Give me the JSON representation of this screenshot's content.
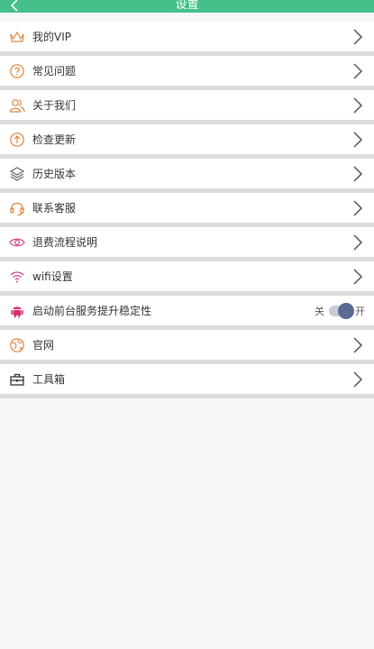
{
  "header": {
    "title": "设置"
  },
  "items": [
    {
      "key": "vip",
      "label": "我的VIP",
      "icon": "crown-icon",
      "color": "#e0833a"
    },
    {
      "key": "faq",
      "label": "常见问题",
      "icon": "question-icon",
      "color": "#e0833a"
    },
    {
      "key": "about",
      "label": "关于我们",
      "icon": "people-icon",
      "color": "#e0833a"
    },
    {
      "key": "update",
      "label": "检查更新",
      "icon": "upload-icon",
      "color": "#e0833a"
    },
    {
      "key": "history",
      "label": "历史版本",
      "icon": "layers-icon",
      "color": "#666666"
    },
    {
      "key": "contact",
      "label": "联系客服",
      "icon": "headset-icon",
      "color": "#e0833a"
    },
    {
      "key": "refund",
      "label": "退费流程说明",
      "icon": "eye-icon",
      "color": "#d6408a"
    },
    {
      "key": "wifi",
      "label": "wifi设置",
      "icon": "wifi-icon",
      "color": "#d6408a"
    },
    {
      "key": "foreground",
      "label": "启动前台服务提升稳定性",
      "icon": "android-icon",
      "color": "#d62f6e"
    },
    {
      "key": "website",
      "label": "官网",
      "icon": "globe-icon",
      "color": "#e0833a"
    },
    {
      "key": "toolbox",
      "label": "工具箱",
      "icon": "toolbox-icon",
      "color": "#333333"
    }
  ],
  "toggle": {
    "off_label": "关",
    "on_label": "开",
    "state": "on"
  },
  "colors": {
    "header": "#45c08a",
    "divider": "#dcdcdc",
    "background": "#f6f6f6",
    "chevron": "#555555"
  }
}
